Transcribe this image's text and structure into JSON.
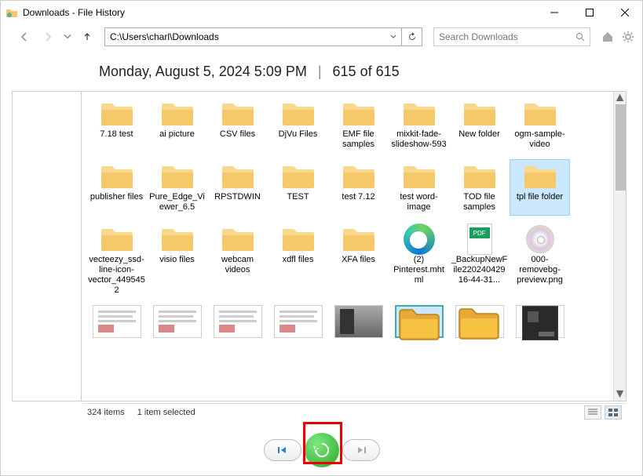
{
  "window": {
    "title": "Downloads - File History"
  },
  "nav": {
    "path": "C:\\Users\\charl\\Downloads",
    "search_placeholder": "Search Downloads"
  },
  "header": {
    "timestamp": "Monday, August 5, 2024 5:09 PM",
    "count": "615 of 615"
  },
  "rows": [
    [
      {
        "label": "7.18 test",
        "type": "folder"
      },
      {
        "label": "ai picture",
        "type": "folder"
      },
      {
        "label": "CSV files",
        "type": "folder"
      },
      {
        "label": "DjVu Files",
        "type": "folder"
      },
      {
        "label": "EMF file samples",
        "type": "folder"
      },
      {
        "label": "mixkit-fade-slideshow-593",
        "type": "folder"
      },
      {
        "label": "New folder",
        "type": "folder"
      },
      {
        "label": "ogm-sample-video",
        "type": "folder"
      }
    ],
    [
      {
        "label": "publisher files",
        "type": "folder"
      },
      {
        "label": "Pure_Edge_Viewer_6.5",
        "type": "folder"
      },
      {
        "label": "RPSTDWIN",
        "type": "folder"
      },
      {
        "label": "TEST",
        "type": "folder"
      },
      {
        "label": "test 7.12",
        "type": "folder"
      },
      {
        "label": "test word-image",
        "type": "folder"
      },
      {
        "label": "TOD file samples",
        "type": "folder"
      },
      {
        "label": "tpl file folder",
        "type": "folder",
        "selected": true
      }
    ],
    [
      {
        "label": "vecteezy_ssd-line-icon-vector_4495452",
        "type": "folder"
      },
      {
        "label": "visio files",
        "type": "folder"
      },
      {
        "label": "webcam videos",
        "type": "folder"
      },
      {
        "label": "xdfl files",
        "type": "folder"
      },
      {
        "label": "XFA files",
        "type": "folder"
      },
      {
        "label": "(2) Pinterest.mhtml",
        "type": "edge"
      },
      {
        "label": "_BackupNewFile220240429 16-44-31...",
        "type": "pdf"
      },
      {
        "label": "000-removebg-preview.png",
        "type": "cd"
      }
    ]
  ],
  "pdf_badge": "PDF",
  "status": {
    "items": "324 items",
    "selected": "1 item selected"
  },
  "thumbs": [
    {
      "type": "doc"
    },
    {
      "type": "doc"
    },
    {
      "type": "doc"
    },
    {
      "type": "doc"
    },
    {
      "type": "photo"
    },
    {
      "type": "bigfolder",
      "selected": true
    },
    {
      "type": "bigfolder"
    },
    {
      "type": "mobo"
    }
  ]
}
